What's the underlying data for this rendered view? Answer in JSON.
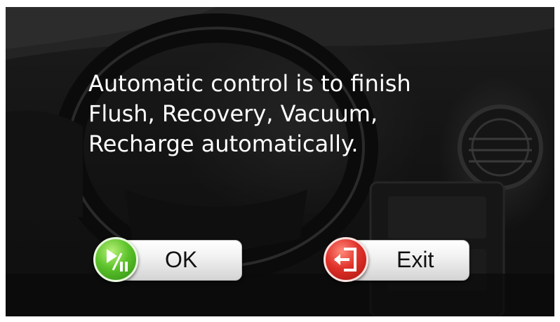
{
  "message": {
    "lines": [
      "Automatic control is to finish",
      "Flush, Recovery, Vacuum,",
      "Recharge automatically."
    ]
  },
  "buttons": {
    "ok": {
      "label": "OK",
      "icon": "play-pause-icon",
      "color": "#4cb520"
    },
    "exit": {
      "label": "Exit",
      "icon": "exit-icon",
      "color": "#d42a22"
    }
  }
}
